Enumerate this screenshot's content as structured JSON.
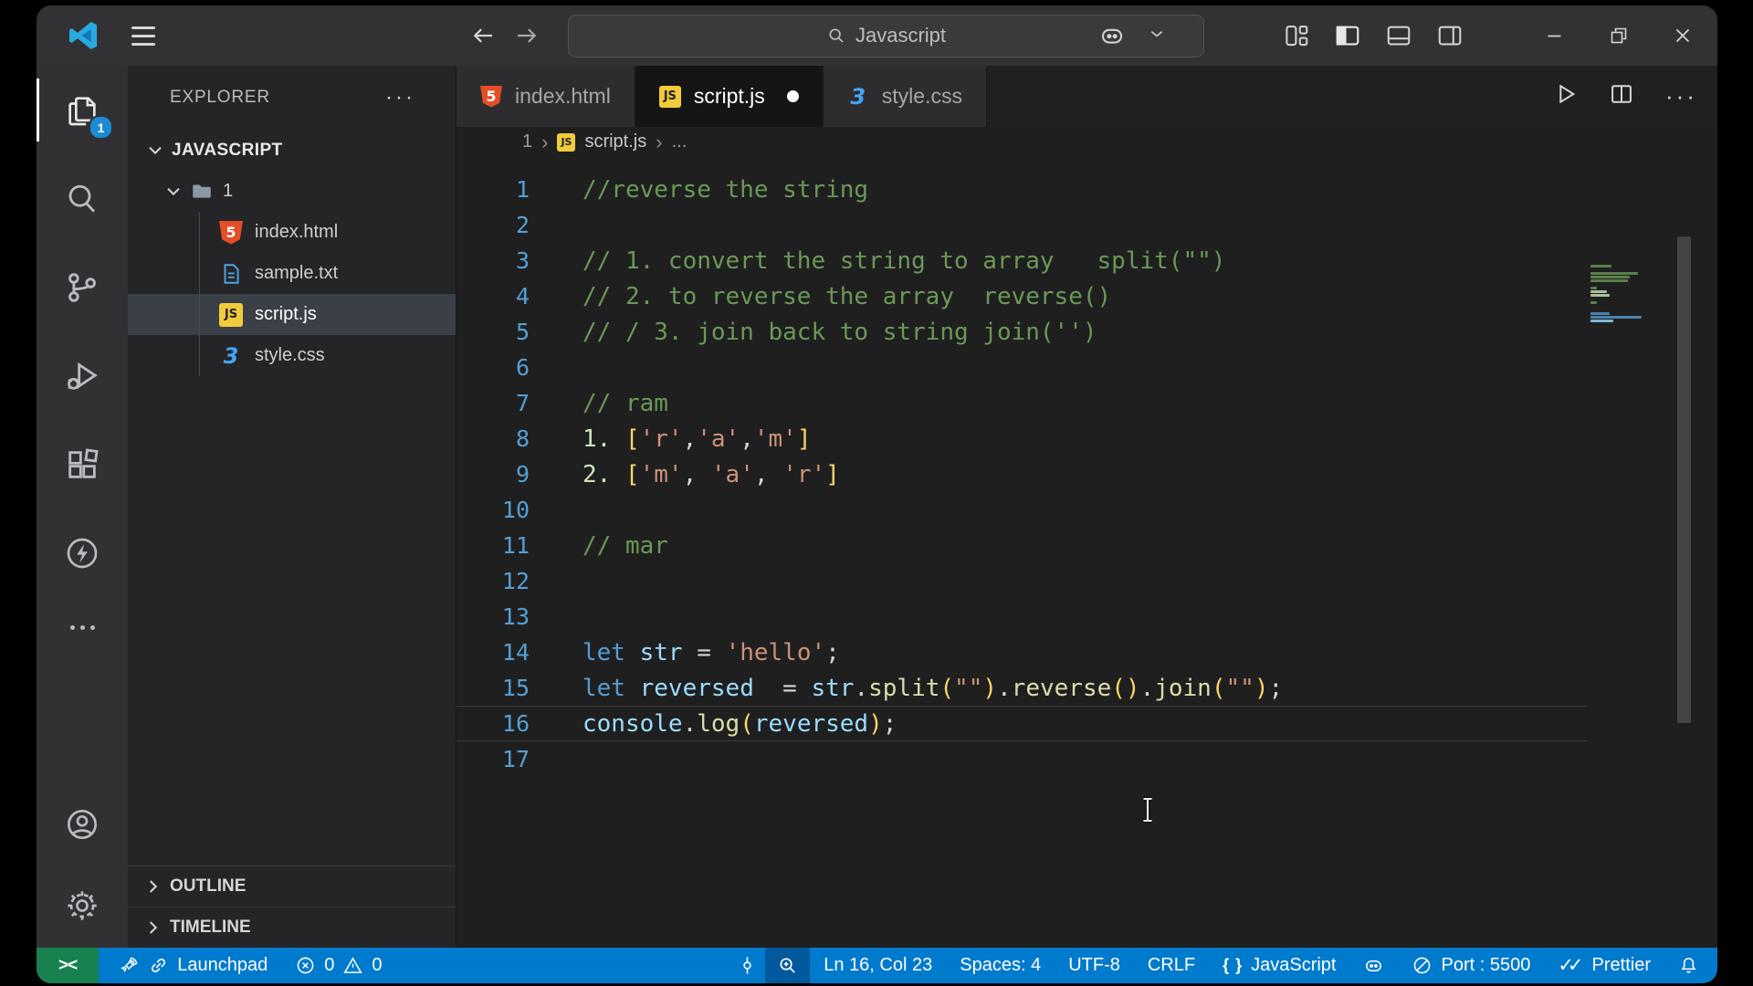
{
  "titlebar": {
    "search_text": "Javascript",
    "icons": [
      "vscode-logo",
      "menu",
      "back-arrow",
      "forward-arrow",
      "search",
      "copilot",
      "chevron-down",
      "customize-layout",
      "toggle-sidebar-left",
      "toggle-panel",
      "toggle-sidebar-right",
      "minimize",
      "restore",
      "close"
    ]
  },
  "activity_bar": {
    "badge": "1",
    "items": [
      "explorer",
      "search",
      "source-control",
      "run-and-debug",
      "extensions",
      "thunder"
    ],
    "bottom_items": [
      "more-actions",
      "account",
      "settings"
    ]
  },
  "sidebar": {
    "title": "EXPLORER",
    "section_label": "JAVASCRIPT",
    "folder_label": "1",
    "files": [
      {
        "name": "index.html",
        "icon": "html",
        "selected": false
      },
      {
        "name": "sample.txt",
        "icon": "txt",
        "selected": false
      },
      {
        "name": "script.js",
        "icon": "js",
        "selected": true
      },
      {
        "name": "style.css",
        "icon": "css",
        "selected": false
      }
    ],
    "panels": [
      {
        "label": "OUTLINE"
      },
      {
        "label": "TIMELINE"
      }
    ]
  },
  "tabs": [
    {
      "label": "index.html",
      "icon": "html",
      "active": false,
      "modified": false
    },
    {
      "label": "script.js",
      "icon": "js",
      "active": true,
      "modified": true
    },
    {
      "label": "style.css",
      "icon": "css",
      "active": false,
      "modified": false
    }
  ],
  "breadcrumb": {
    "folder": "1",
    "file": "script.js",
    "tail": "..."
  },
  "editor": {
    "current_line": 16,
    "lines": [
      [
        [
          "cm",
          "//reverse the string"
        ]
      ],
      [],
      [
        [
          "cm",
          "// 1. convert the string to array   split(\"\")"
        ]
      ],
      [
        [
          "cm",
          "// 2. to reverse the array  reverse()"
        ]
      ],
      [
        [
          "cm",
          "// / 3. join back to string join('')"
        ]
      ],
      [],
      [
        [
          "cm",
          "// ram"
        ]
      ],
      [
        [
          "num",
          "1."
        ],
        [
          "pn",
          " "
        ],
        [
          "br",
          "["
        ],
        [
          "str",
          "'r'"
        ],
        [
          "pn",
          ","
        ],
        [
          "str",
          "'a'"
        ],
        [
          "pn",
          ","
        ],
        [
          "str",
          "'m'"
        ],
        [
          "br",
          "]"
        ]
      ],
      [
        [
          "num",
          "2."
        ],
        [
          "pn",
          " "
        ],
        [
          "br",
          "["
        ],
        [
          "str",
          "'m'"
        ],
        [
          "pn",
          ", "
        ],
        [
          "str",
          "'a'"
        ],
        [
          "pn",
          ", "
        ],
        [
          "str",
          "'r'"
        ],
        [
          "br",
          "]"
        ]
      ],
      [],
      [
        [
          "cm",
          "// mar"
        ]
      ],
      [],
      [],
      [
        [
          "kw",
          "let"
        ],
        [
          "pn",
          " "
        ],
        [
          "var",
          "str"
        ],
        [
          "pn",
          " = "
        ],
        [
          "str",
          "'hello'"
        ],
        [
          "pn",
          ";"
        ]
      ],
      [
        [
          "kw",
          "let"
        ],
        [
          "pn",
          " "
        ],
        [
          "var",
          "reversed"
        ],
        [
          "pn",
          "  = "
        ],
        [
          "var",
          "str"
        ],
        [
          "pn",
          "."
        ],
        [
          "fn",
          "split"
        ],
        [
          "br",
          "("
        ],
        [
          "str",
          "\"\""
        ],
        [
          "br",
          ")"
        ],
        [
          "pn",
          "."
        ],
        [
          "fn",
          "reverse"
        ],
        [
          "br",
          "()"
        ],
        [
          "pn",
          "."
        ],
        [
          "fn",
          "join"
        ],
        [
          "br",
          "("
        ],
        [
          "str",
          "\"\""
        ],
        [
          "br",
          ")"
        ],
        [
          "pn",
          ";"
        ]
      ],
      [
        [
          "var",
          "console"
        ],
        [
          "pn",
          "."
        ],
        [
          "fn",
          "log"
        ],
        [
          "br",
          "("
        ],
        [
          "var",
          "reversed"
        ],
        [
          "br",
          ")"
        ],
        [
          "pn",
          ";"
        ]
      ],
      []
    ]
  },
  "status_bar": {
    "remote_glyph": "><",
    "launchpad_label": "Launchpad",
    "errors": "0",
    "warnings": "0",
    "cursor_position": "Ln 16, Col 23",
    "indentation": "Spaces: 4",
    "encoding": "UTF-8",
    "eol": "CRLF",
    "braces_glyph": "{ }",
    "language": "JavaScript",
    "port": "Port : 5500",
    "formatter": "Prettier",
    "checks_glyph": "✓✓"
  },
  "colors": {
    "status_bar": "#007acc",
    "remote_green": "#17824f",
    "badge_blue": "#1d8bd4",
    "editor_bg": "#1f1f20",
    "comment": "#6a9955",
    "string": "#ce9178",
    "keyword": "#569cd6",
    "bracket": "#ffd666"
  }
}
